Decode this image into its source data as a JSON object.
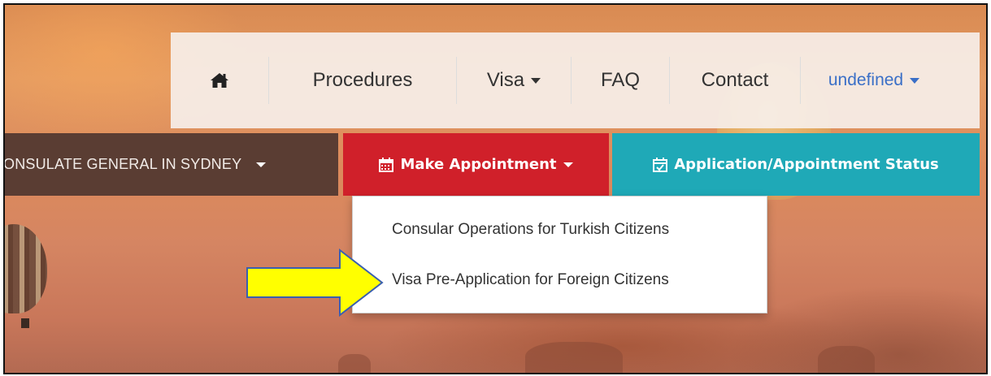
{
  "nav": {
    "home_icon": "home-icon",
    "procedures": "Procedures",
    "visa": "Visa",
    "faq": "FAQ",
    "contact": "Contact",
    "language": "undefined"
  },
  "bar": {
    "consulate": "ONSULATE GENERAL IN SYDNEY",
    "make_appointment": "Make Appointment",
    "status": "Application/Appointment Status"
  },
  "dropdown": {
    "items": [
      "Consular Operations for Turkish Citizens",
      "Visa Pre-Application for Foreign Citizens"
    ]
  },
  "colors": {
    "consulate_bg": "#5a3d33",
    "make_appointment_bg": "#d0202a",
    "status_bg": "#1fa9b7",
    "link_blue": "#3a6fc7",
    "annotation_arrow": "#ffff00"
  }
}
